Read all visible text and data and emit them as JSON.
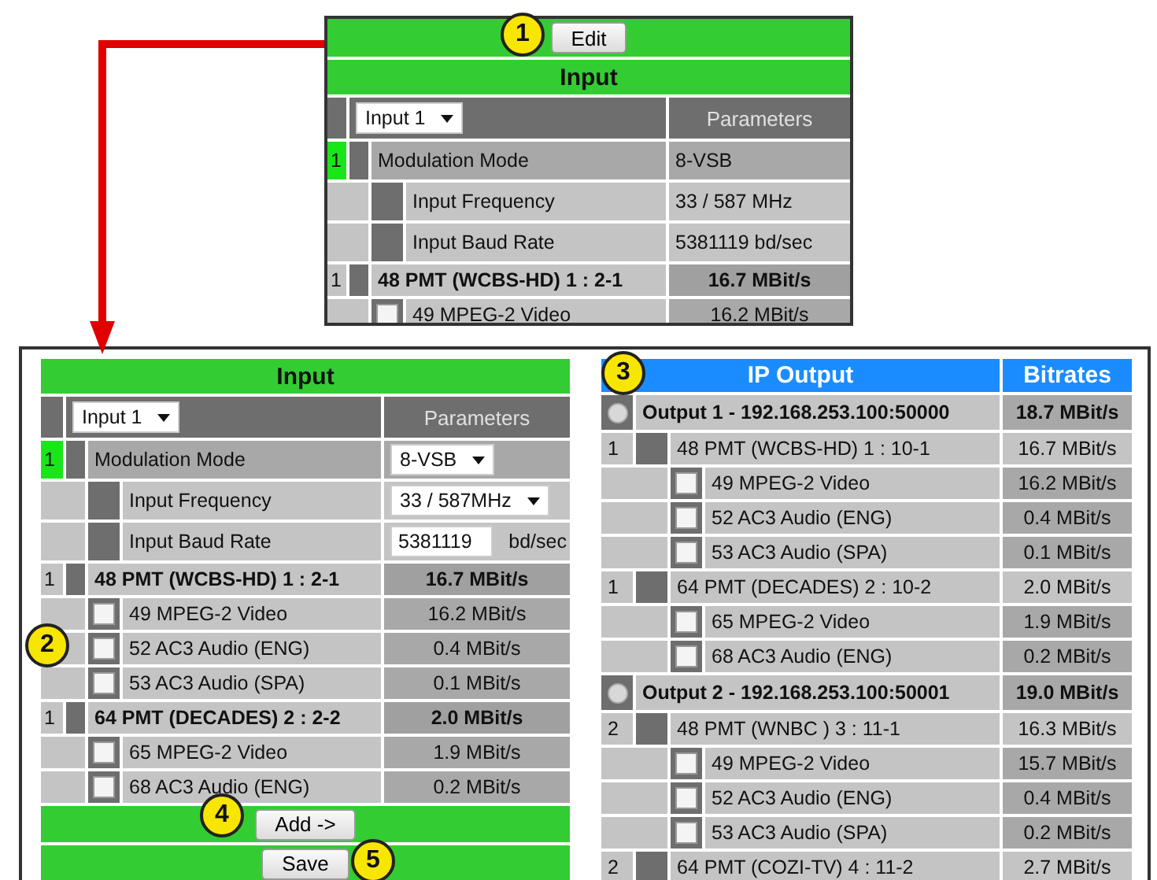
{
  "top_panel": {
    "callout": "1",
    "edit_button": "Edit",
    "title": "Input",
    "input_select": "Input 1",
    "params_header": "Parameters",
    "rows": [
      {
        "kind": "mode",
        "index": "1",
        "active": true,
        "label": "Modulation Mode",
        "field": {
          "kind": "text",
          "value": "8-VSB"
        },
        "children": [
          {
            "label": "Input Frequency",
            "kind": "text",
            "value": "33 / 587 MHz"
          },
          {
            "label": "Input Baud Rate",
            "kind": "text",
            "value": "5381119 bd/sec"
          }
        ]
      },
      {
        "kind": "pmt",
        "index": "1",
        "active": false,
        "label": "48 PMT (WCBS-HD) 1 : 2-1",
        "value": "16.7 MBit/s",
        "children": [
          {
            "label": "49 MPEG-2 Video",
            "value": "16.2 MBit/s",
            "checked": false
          }
        ]
      }
    ]
  },
  "input_panel": {
    "title": "Input",
    "input_select": "Input 1",
    "params_header": "Parameters",
    "callout_streams": "2",
    "add_button": "Add ->",
    "callout_add": "4",
    "save_button": "Save",
    "callout_save": "5",
    "rows": [
      {
        "kind": "mode",
        "index": "1",
        "active": true,
        "label": "Modulation Mode",
        "field": {
          "kind": "select",
          "value": "8-VSB"
        },
        "children": [
          {
            "label": "Input Frequency",
            "kind": "select",
            "value": "33 / 587MHz"
          },
          {
            "label": "Input Baud Rate",
            "kind": "input",
            "value": "5381119",
            "unit": "bd/sec"
          }
        ]
      },
      {
        "kind": "pmt",
        "index": "1",
        "active": false,
        "label": "48 PMT (WCBS-HD) 1 : 2-1",
        "value": "16.7 MBit/s",
        "children": [
          {
            "label": "49 MPEG-2 Video",
            "value": "16.2 MBit/s",
            "checked": false
          },
          {
            "label": "52 AC3 Audio (ENG)",
            "value": "0.4 MBit/s",
            "checked": false
          },
          {
            "label": "53 AC3 Audio (SPA)",
            "value": "0.1 MBit/s",
            "checked": false
          }
        ]
      },
      {
        "kind": "pmt",
        "index": "1",
        "active": false,
        "label": "64 PMT (DECADES) 2 : 2-2",
        "value": "2.0 MBit/s",
        "children": [
          {
            "label": "65 MPEG-2 Video",
            "value": "1.9 MBit/s",
            "checked": false
          },
          {
            "label": "68 AC3 Audio (ENG)",
            "value": "0.2 MBit/s",
            "checked": false
          }
        ]
      }
    ]
  },
  "output_panel": {
    "callout": "3",
    "title": "IP Output",
    "bitrates_header": "Bitrates",
    "outputs": [
      {
        "label": "Output 1 - 192.168.253.100:50000",
        "value": "18.7 MBit/s",
        "selected": false,
        "children": [
          {
            "index": "1",
            "label": "48 PMT (WCBS-HD) 1 : 10-1",
            "value": "16.7 MBit/s",
            "children": [
              {
                "label": "49 MPEG-2 Video",
                "value": "16.2 MBit/s",
                "checked": false
              },
              {
                "label": "52 AC3 Audio (ENG)",
                "value": "0.4 MBit/s",
                "checked": false
              },
              {
                "label": "53 AC3 Audio (SPA)",
                "value": "0.1 MBit/s",
                "checked": false
              }
            ]
          },
          {
            "index": "1",
            "label": "64 PMT (DECADES) 2 : 10-2",
            "value": "2.0 MBit/s",
            "children": [
              {
                "label": "65 MPEG-2 Video",
                "value": "1.9 MBit/s",
                "checked": false
              },
              {
                "label": "68 AC3 Audio (ENG)",
                "value": "0.2 MBit/s",
                "checked": false
              }
            ]
          }
        ]
      },
      {
        "label": "Output 2 - 192.168.253.100:50001",
        "value": "19.0 MBit/s",
        "selected": false,
        "children": [
          {
            "index": "2",
            "label": "48 PMT (WNBC ) 3 : 11-1",
            "value": "16.3 MBit/s",
            "children": [
              {
                "label": "49 MPEG-2 Video",
                "value": "15.7 MBit/s",
                "checked": false
              },
              {
                "label": "52 AC3 Audio (ENG)",
                "value": "0.4 MBit/s",
                "checked": false
              },
              {
                "label": "53 AC3 Audio (SPA)",
                "value": "0.2 MBit/s",
                "checked": false
              }
            ]
          },
          {
            "index": "2",
            "label": "64 PMT (COZI-TV) 4 : 11-2",
            "value": "2.7 MBit/s"
          }
        ]
      }
    ]
  }
}
